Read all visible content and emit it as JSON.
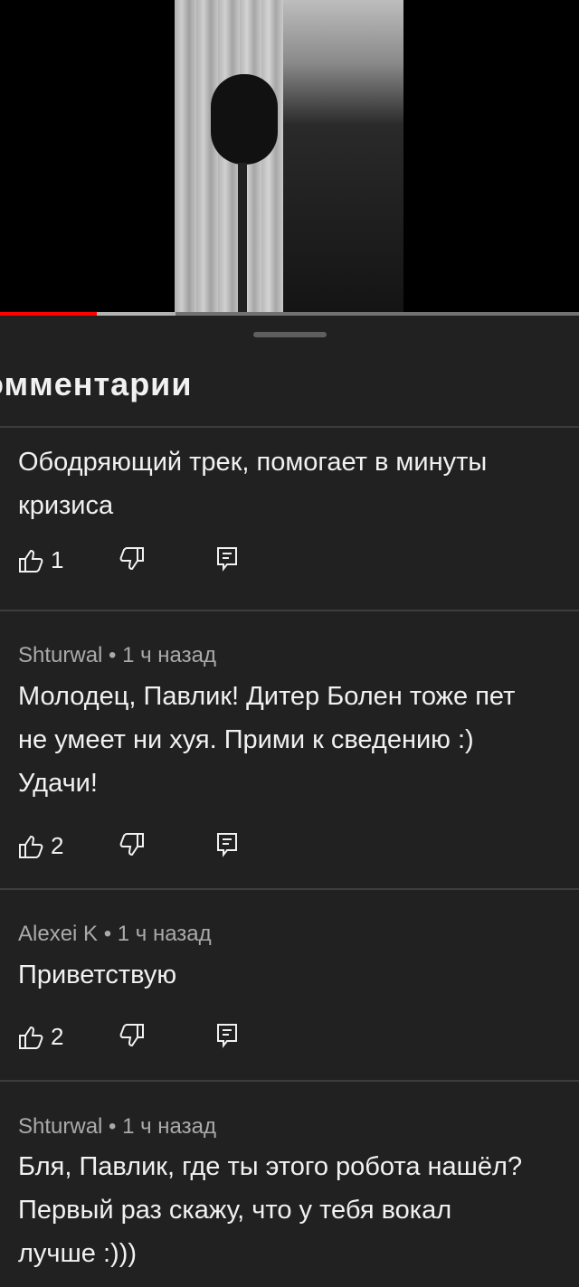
{
  "sheet": {
    "title": "омментарии"
  },
  "comments": [
    {
      "author": "",
      "time": "",
      "text": "Ободряющий трек, помогает в минуты\nкризиса",
      "likes": "1"
    },
    {
      "author": "Shturwal",
      "time": "1 ч назад",
      "meta": "Shturwal • 1 ч назад",
      "text": "Молодец, Павлик! Дитер Болен тоже пет\nне умеет ни хуя. Прими к сведению :)\nУдачи!",
      "likes": "2"
    },
    {
      "author": "Alexei K",
      "time": "1 ч назад",
      "meta": "Alexei K • 1 ч назад",
      "text": "Приветствую",
      "likes": "2"
    },
    {
      "author": "Shturwal",
      "time": "1 ч назад",
      "meta": "Shturwal • 1 ч назад",
      "text": "Бля, Павлик, где ты этого робота нашёл?\nПервый раз скажу, что у тебя вокал\nлучше :)))"
    }
  ],
  "icons": {
    "like": "thumb-up-icon",
    "dislike": "thumb-down-icon",
    "reply": "reply-icon"
  },
  "colors": {
    "background": "#212121",
    "progress_played": "#ff0000",
    "meta_text": "#aaaaaa"
  },
  "video": {
    "progress_fraction": 0.167
  }
}
